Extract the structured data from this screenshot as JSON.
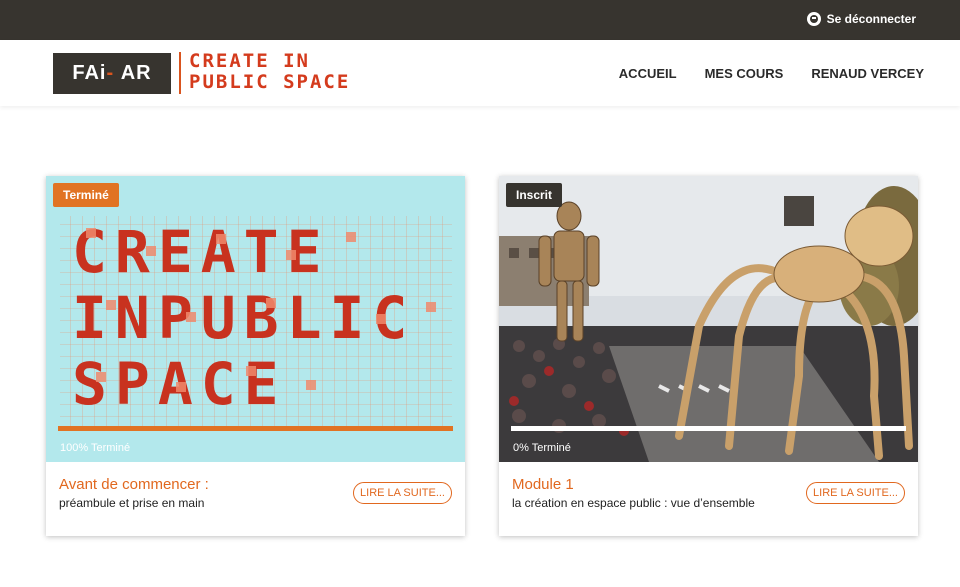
{
  "topbar": {
    "logout_label": "Se déconnecter",
    "bg": "#37342f"
  },
  "header": {
    "logo_left_a": "FAi",
    "logo_left_dash": "-",
    "logo_left_b": "AR",
    "logo_right_line1": "CREATE IN",
    "logo_right_line2": "PUBLIC SPACE"
  },
  "nav": {
    "items": [
      "ACCUEIL",
      "MES COURS",
      "RENAUD VERCEY"
    ]
  },
  "accent": "#e1681f",
  "courses": [
    {
      "badge": "Terminé",
      "progress_percent": 100,
      "progress_label": "100% Terminé",
      "title": "Avant de commencer :",
      "subtitle": "préambule et prise en main",
      "button": "LIRE LA SUITE...",
      "image_icon": "create-in-public-space-poster"
    },
    {
      "badge": "Inscrit",
      "progress_percent": 0,
      "progress_label": "0% Terminé",
      "title": "Module 1",
      "subtitle": "la création en espace public : vue d’ensemble",
      "button": "LIRE LA SUITE...",
      "image_icon": "street-performance-photo"
    }
  ]
}
